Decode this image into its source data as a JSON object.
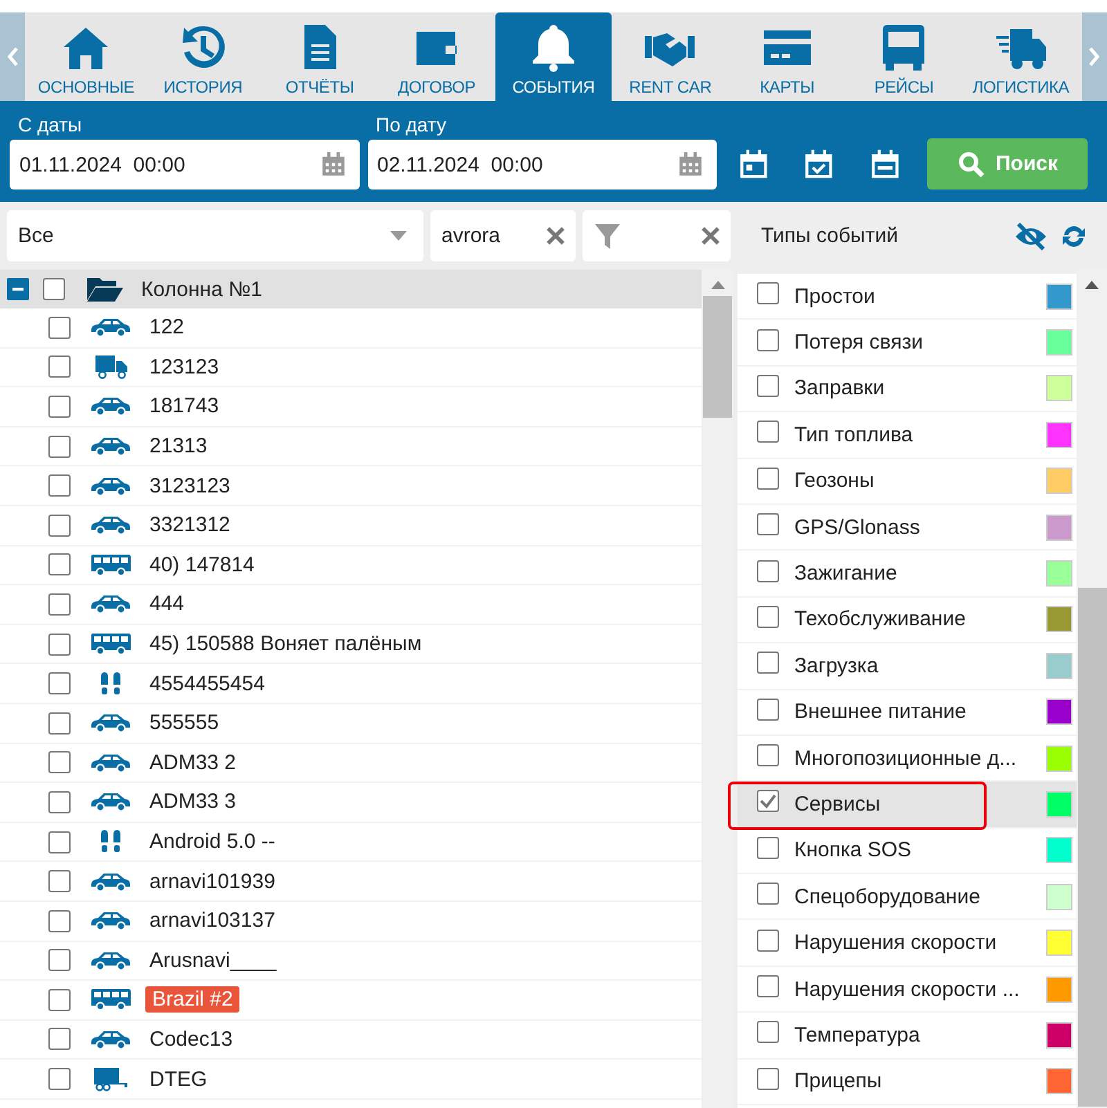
{
  "tabs": [
    {
      "label": "ОСНОВНЫЕ",
      "selected": false
    },
    {
      "label": "ИСТОРИЯ",
      "selected": false
    },
    {
      "label": "ОТЧЁТЫ",
      "selected": false
    },
    {
      "label": "ДОГОВОР",
      "selected": false
    },
    {
      "label": "СОБЫТИЯ",
      "selected": true
    },
    {
      "label": "RENT CAR",
      "selected": false
    },
    {
      "label": "КАРТЫ",
      "selected": false
    },
    {
      "label": "РЕЙСЫ",
      "selected": false
    },
    {
      "label": "ЛОГИСТИКА",
      "selected": false
    }
  ],
  "date_from": {
    "label": "С даты",
    "value": "01.11.2024  00:00"
  },
  "date_to": {
    "label": "По дату",
    "value": "02.11.2024  00:00"
  },
  "search_button": "Поиск",
  "filters": {
    "group": "Все",
    "name_filter": "avrora"
  },
  "event_types_title": "Типы событий",
  "tree": {
    "label": "Колонна №1",
    "expanded": true,
    "checked": false,
    "children": [
      {
        "label": "122",
        "kind": "car",
        "checked": false
      },
      {
        "label": "123123",
        "kind": "truck",
        "checked": false
      },
      {
        "label": "181743",
        "kind": "car",
        "checked": false
      },
      {
        "label": "21313",
        "kind": "car",
        "checked": false
      },
      {
        "label": "3123123",
        "kind": "car",
        "checked": false
      },
      {
        "label": "3321312",
        "kind": "car",
        "checked": false
      },
      {
        "label": "40) 147814",
        "kind": "bus",
        "checked": false
      },
      {
        "label": "444",
        "kind": "car",
        "checked": false
      },
      {
        "label": "45) 150588 Воняет палёным",
        "kind": "bus",
        "checked": false
      },
      {
        "label": "4554455454",
        "kind": "person",
        "checked": false
      },
      {
        "label": "555555",
        "kind": "car",
        "checked": false
      },
      {
        "label": "ADM33 2",
        "kind": "car",
        "checked": false
      },
      {
        "label": "ADM33 3",
        "kind": "car",
        "checked": false
      },
      {
        "label": "Android 5.0 --",
        "kind": "person",
        "checked": false
      },
      {
        "label": "arnavi101939",
        "kind": "car",
        "checked": false
      },
      {
        "label": "arnavi103137",
        "kind": "car",
        "checked": false
      },
      {
        "label": "Arusnavi____",
        "kind": "car",
        "checked": false
      },
      {
        "label": "Brazil #2",
        "kind": "bus",
        "checked": false,
        "color": "#e8553a"
      },
      {
        "label": "Codec13",
        "kind": "car",
        "checked": false
      },
      {
        "label": "DTEG",
        "kind": "trailer",
        "checked": false
      }
    ]
  },
  "event_types": [
    {
      "label": "Простои",
      "checked": false,
      "highlighted": false,
      "color": "#3399cc"
    },
    {
      "label": "Потеря связи",
      "checked": false,
      "highlighted": false,
      "color": "#66ff99"
    },
    {
      "label": "Заправки",
      "checked": false,
      "highlighted": false,
      "color": "#ccff99"
    },
    {
      "label": "Тип топлива",
      "checked": false,
      "highlighted": false,
      "color": "#ff33ff"
    },
    {
      "label": "Геозоны",
      "checked": false,
      "highlighted": false,
      "color": "#ffcc66"
    },
    {
      "label": "GPS/Glonass",
      "checked": false,
      "highlighted": false,
      "color": "#cc99cc"
    },
    {
      "label": "Зажигание",
      "checked": false,
      "highlighted": false,
      "color": "#99ff99"
    },
    {
      "label": "Техобслуживание",
      "checked": false,
      "highlighted": false,
      "color": "#999933"
    },
    {
      "label": "Загрузка",
      "checked": false,
      "highlighted": false,
      "color": "#99cccc"
    },
    {
      "label": "Внешнее питание",
      "checked": false,
      "highlighted": false,
      "color": "#9900cc"
    },
    {
      "label": "Многопозиционные д...",
      "checked": false,
      "highlighted": false,
      "color": "#99ff00"
    },
    {
      "label": "Сервисы",
      "checked": true,
      "highlighted": true,
      "color": "#00ff66"
    },
    {
      "label": "Кнопка SOS",
      "checked": false,
      "highlighted": false,
      "color": "#00ffcc"
    },
    {
      "label": "Спецоборудование",
      "checked": false,
      "highlighted": false,
      "color": "#ccffcc"
    },
    {
      "label": "Нарушения скорости",
      "checked": false,
      "highlighted": false,
      "color": "#ffff33"
    },
    {
      "label": "Нарушения скорости ...",
      "checked": false,
      "highlighted": false,
      "color": "#ff9900"
    },
    {
      "label": "Температура",
      "checked": false,
      "highlighted": false,
      "color": "#cc0066"
    },
    {
      "label": "Прицепы",
      "checked": false,
      "highlighted": false,
      "color": "#ff6633"
    }
  ]
}
